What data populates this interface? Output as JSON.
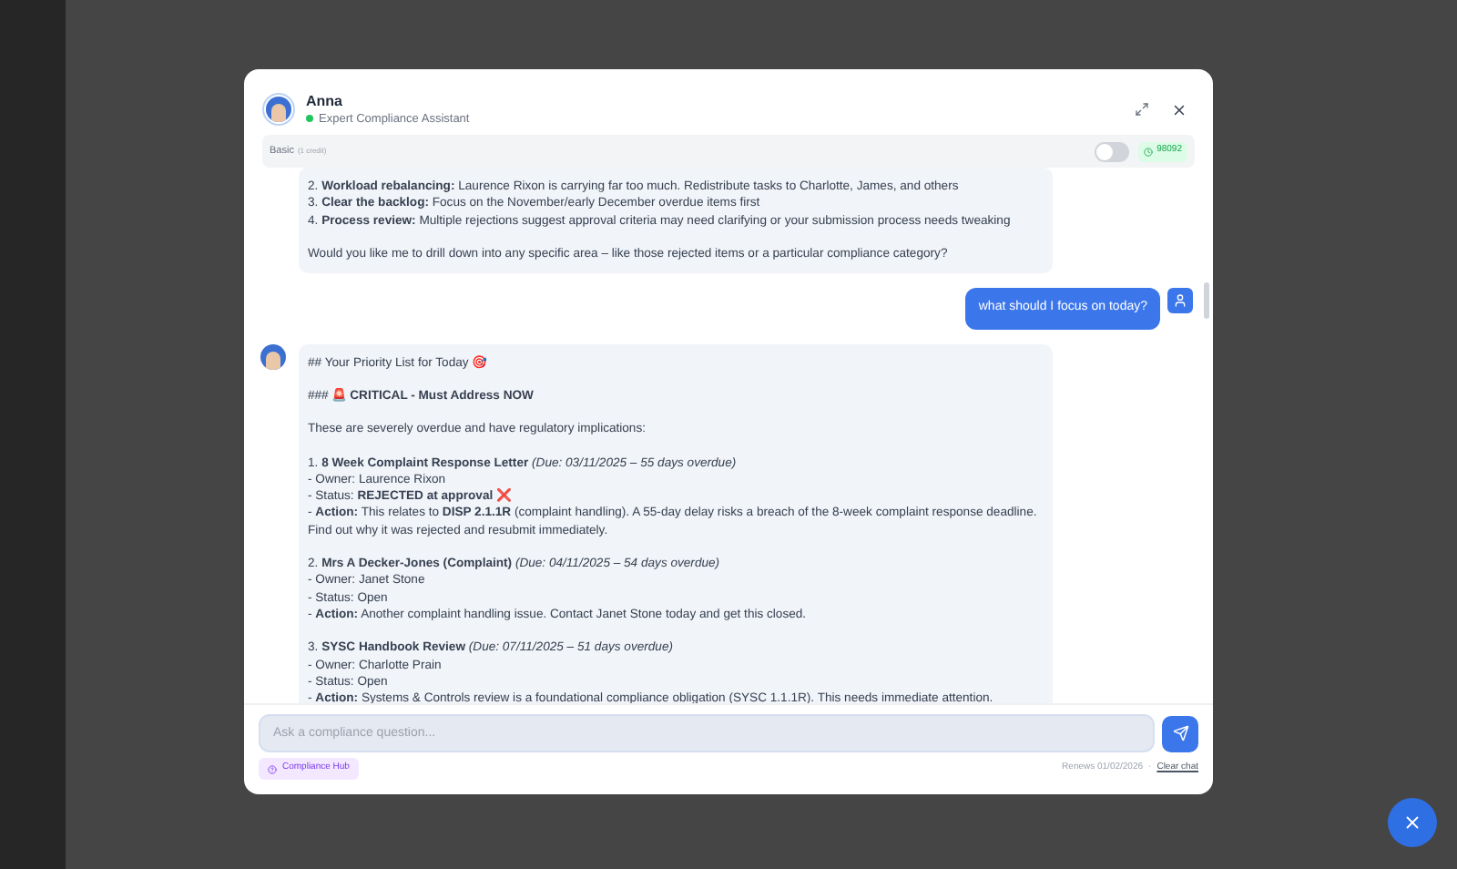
{
  "assistant": {
    "name": "Anna",
    "subtitle": "Expert Compliance Assistant",
    "online": true
  },
  "mode": {
    "label": "Basic",
    "note": "(1 credit)",
    "toggle_on": false,
    "credits": "98092"
  },
  "messages": [
    {
      "kind": "assistant",
      "avatar": false,
      "paragraphs": [
        [
          "2. **Workload rebalancing:** Laurence Rixon is carrying far too much. Redistribute tasks to Charlotte, James, and others",
          "3. **Clear the backlog:** Focus on the November/early December overdue items first",
          "4. **Process review:** Multiple rejections suggest approval criteria may need clarifying or your submission process needs tweaking"
        ],
        [
          "Would you like me to drill down into any specific area – like those rejected items or a particular compliance category?"
        ]
      ]
    },
    {
      "kind": "user",
      "text": "what should I focus on today?"
    },
    {
      "kind": "assistant",
      "avatar": true,
      "paragraphs": [
        [
          "## Your Priority List for Today 🎯"
        ],
        [
          "### 🚨 **CRITICAL - Must Address NOW**"
        ],
        [
          "These are severely overdue and have regulatory implications:"
        ],
        [
          "1. **8 Week Complaint Response Letter** *(Due: 03/11/2025 – 55 days overdue)*",
          "- Owner: Laurence Rixon",
          "- Status: **REJECTED at approval** ❌",
          "- **Action:** This relates to **DISP 2.1.1R** (complaint handling). A 55-day delay risks a breach of the 8-week complaint response deadline. Find out why it was rejected and resubmit immediately."
        ],
        [
          "2. **Mrs A Decker-Jones (Complaint)** *(Due: 04/11/2025 – 54 days overdue)*",
          "- Owner: Janet Stone",
          "- Status: Open",
          "- **Action:** Another complaint handling issue. Contact Janet Stone today and get this closed."
        ],
        [
          "3. **SYSC Handbook Review** *(Due: 07/11/2025 – 51 days overdue)*",
          "- Owner: Charlotte Prain",
          "- Status: Open",
          "- **Action:** Systems & Controls review is a foundational compliance obligation (SYSC 1.1.1R). This needs immediate attention."
        ]
      ]
    }
  ],
  "input": {
    "placeholder": "Ask a compliance question..."
  },
  "footer": {
    "hub": "Compliance Hub",
    "renews": "Renews 01/02/2026",
    "separator": "·",
    "clear": "Clear chat"
  }
}
